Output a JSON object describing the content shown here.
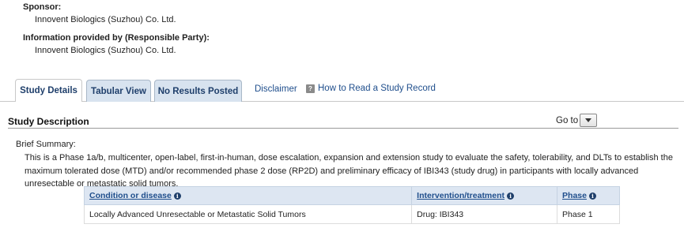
{
  "sponsor": {
    "label": "Sponsor:",
    "value": "Innovent Biologics (Suzhou) Co. Ltd."
  },
  "responsible_party": {
    "label": "Information provided by (Responsible Party):",
    "value": "Innovent Biologics (Suzhou) Co. Ltd."
  },
  "tabs": [
    {
      "label": "Study Details",
      "active": true
    },
    {
      "label": "Tabular View",
      "active": false
    },
    {
      "label": "No Results Posted",
      "active": false
    }
  ],
  "links": {
    "disclaimer": "Disclaimer",
    "how_to_read": "How to Read a Study Record",
    "help_icon_glyph": "?"
  },
  "section": {
    "title": "Study Description",
    "goto_label": "Go to"
  },
  "brief_summary": {
    "label": "Brief Summary:",
    "text": "This is a Phase 1a/b, multicenter, open-label, first-in-human, dose escalation, expansion and extension study to evaluate the safety, tolerability, and DLTs to establish the maximum tolerated dose (MTD) and/or recommended phase 2 dose (RP2D) and preliminary efficacy of IBI343 (study drug) in participants with locally advanced unresectable or metastatic solid tumors."
  },
  "table": {
    "headers": [
      "Condition or disease",
      "Intervention/treatment",
      "Phase"
    ],
    "info_glyph": "i",
    "rows": [
      [
        "Locally Advanced Unresectable or Metastatic Solid Tumors",
        "Drug: IBI343",
        "Phase 1"
      ]
    ]
  },
  "colors": {
    "tab_inactive_bg": "#d8e3ef",
    "link": "#1f4e8c",
    "table_header_bg": "#dde6f2"
  }
}
